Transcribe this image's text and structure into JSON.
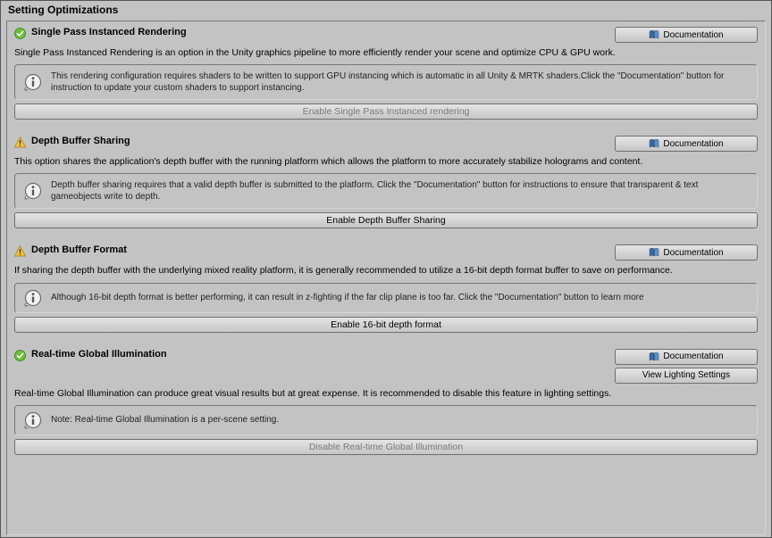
{
  "panel": {
    "title": "Setting Optimizations"
  },
  "buttons": {
    "documentation_label": "Documentation",
    "view_lighting_label": "View Lighting Settings"
  },
  "sections": {
    "spir": {
      "title": "Single Pass Instanced Rendering",
      "description": "Single Pass Instanced Rendering is an option in the Unity graphics pipeline to more efficiently render your scene and optimize CPU & GPU work.",
      "info": "This rendering configuration requires shaders to be written to support GPU instancing which is automatic in all Unity & MRTK shaders.Click the \"Documentation\" button for instruction to update your custom shaders to support instancing.",
      "action_label": "Enable Single Pass Instanced rendering"
    },
    "dbs": {
      "title": "Depth Buffer Sharing",
      "description": "This option shares the application's depth buffer with the running platform which allows the platform to more accurately stabilize holograms and content.",
      "info": "Depth buffer sharing requires that a valid depth buffer is submitted to the platform. Click the \"Documentation\" button for instructions to ensure that transparent & text gameobjects write to depth.",
      "action_label": "Enable Depth Buffer Sharing"
    },
    "dbf": {
      "title": "Depth Buffer Format",
      "description": "If sharing the depth buffer with the underlying mixed reality platform, it is generally recommended to utilize a 16-bit depth format buffer to save on performance.",
      "info": "Although 16-bit depth format is better performing, it can result in z-fighting if the far clip plane is too far. Click the \"Documentation\" button to learn more",
      "action_label": "Enable 16-bit depth format"
    },
    "rtgi": {
      "title": "Real-time Global Illumination",
      "description": "Real-time Global Illumination can produce great visual results but at great expense. It is recommended to disable this feature in lighting settings.",
      "info": "Note: Real-time Global Illumination is a per-scene setting.",
      "action_label": "Disable Real-time Global Illumination"
    }
  }
}
